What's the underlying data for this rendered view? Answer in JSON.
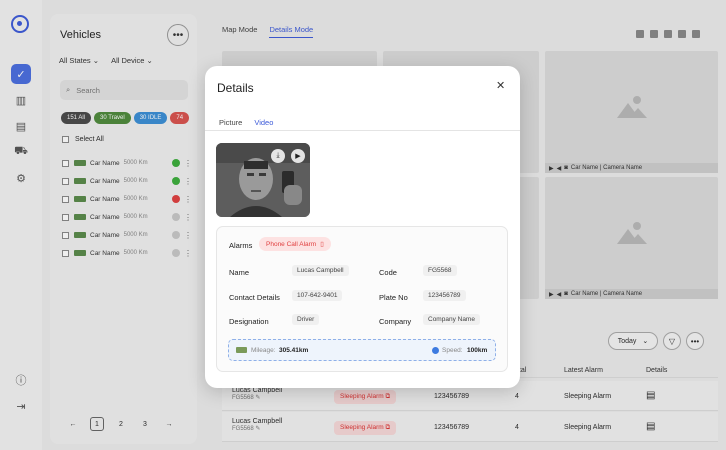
{
  "vehicles": {
    "title": "Vehicles",
    "filter_states": "All States",
    "filter_device": "All Device",
    "search_placeholder": "Search",
    "chips": [
      {
        "label": "151 All",
        "color": "#4a4a4a"
      },
      {
        "label": "30 Travel",
        "color": "#4f8a3c"
      },
      {
        "label": "30 IDLE",
        "color": "#3b8fd6"
      },
      {
        "label": "74",
        "color": "#d9534f"
      }
    ],
    "select_all": "Select All",
    "items": [
      {
        "name": "Car Name",
        "km": "5000 Km",
        "status": "#3cae3c"
      },
      {
        "name": "Car Name",
        "km": "5000 Km",
        "status": "#3cae3c"
      },
      {
        "name": "Car Name",
        "km": "5000 Km",
        "status": "#e04040"
      },
      {
        "name": "Car Name",
        "km": "5000 Km",
        "status": "#c8c8c8"
      },
      {
        "name": "Car Name",
        "km": "5000 Km",
        "status": "#c8c8c8"
      },
      {
        "name": "Car Name",
        "km": "5000 Km",
        "status": "#c8c8c8"
      }
    ],
    "pages": [
      "1",
      "2",
      "3"
    ],
    "current_page": "1"
  },
  "main": {
    "tabs": [
      "Map Mode",
      "Details Mode"
    ],
    "active_tab": "Details Mode",
    "camera_label": "Car Name | Camera Name",
    "today_label": "Today",
    "table_headers": {
      "total": "otal",
      "latest_alarm": "Latest Alarm",
      "details": "Details"
    },
    "rows": [
      {
        "name": "Lucas Campbell",
        "code": "FG5568",
        "alarm": "Sleeping Alarm",
        "plate": "123456789",
        "total": "4",
        "latest": "Sleeping Alarm"
      },
      {
        "name": "Lucas Campbell",
        "code": "FG5568",
        "alarm": "Sleeping Alarm",
        "plate": "123456789",
        "total": "4",
        "latest": "Sleeping Alarm"
      }
    ]
  },
  "modal": {
    "title": "Details",
    "tabs": [
      "Picture",
      "Video"
    ],
    "active_tab": "Video",
    "alarms_label": "Alarms",
    "alarm_tag": "Phone Call Alarm",
    "fields": {
      "name_label": "Name",
      "name_value": "Lucas Campbell",
      "code_label": "Code",
      "code_value": "FG5568",
      "contact_label": "Contact Details",
      "contact_value": "107-642-9401",
      "plate_label": "Plate No",
      "plate_value": "123456789",
      "designation_label": "Designation",
      "designation_value": "Driver",
      "company_label": "Company",
      "company_value": "Company Name"
    },
    "mileage_label": "Mileage:",
    "mileage_value": "305.41km",
    "speed_label": "Speed:",
    "speed_value": "100km"
  },
  "colors": {
    "accent": "#3d5bd9",
    "alarm": "#e04040"
  }
}
